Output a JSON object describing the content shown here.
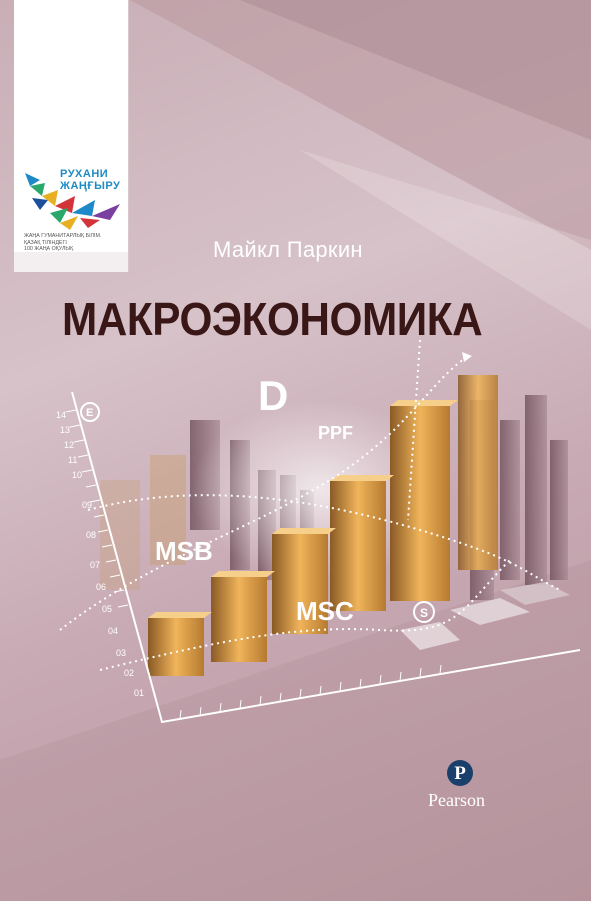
{
  "series_panel": {
    "logo_line1": "РУХАНИ",
    "logo_line2": "ЖАҢҒЫРУ",
    "program_lines": [
      "ЖАҢА ГУМАНИТАРЛЫҚ БІЛІМ.",
      "ҚАЗАҚ ТІЛІНДЕГІ",
      "100 ЖАҢА ОҚУЛЫҚ"
    ]
  },
  "author": "Майкл Паркин",
  "title": "МАКРОЭКОНОМИКА",
  "illustration": {
    "labels": {
      "d": "D",
      "ppf": "PPF",
      "msb": "MSB",
      "msc": "MSC",
      "e_circle": "E",
      "s_circle": "S"
    },
    "axis_ticks": [
      "01",
      "02",
      "03",
      "04",
      "05",
      "06",
      "07",
      "08",
      "09",
      "10",
      "11",
      "12",
      "13",
      "14"
    ]
  },
  "publisher": "Pearson",
  "publisher_logo_letter": "P",
  "colors": {
    "background": "#c9aeb6",
    "title": "#3a1717",
    "bars": "#d99a3a",
    "publisher_blue": "#1a3f6b"
  }
}
